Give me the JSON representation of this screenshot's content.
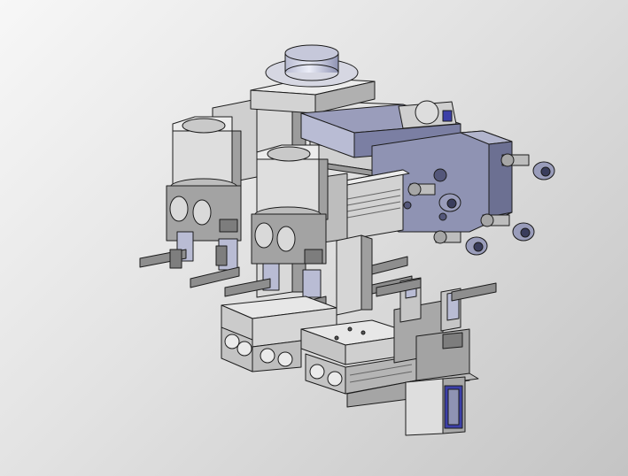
{
  "viewport": {
    "background_top": "#f7f7f7",
    "background_bottom": "#c4c4c4"
  },
  "model": {
    "palette": {
      "body_light": "#d8d8d8",
      "body_mid": "#bdbdbd",
      "body_dark": "#8e8e8e",
      "steel_blue": "#8f93b3",
      "steel_blue_dark": "#6c7092",
      "steel_blue_light": "#b9bcd4",
      "accent_blue": "#3c3fa8",
      "edge": "#1c1c1c"
    }
  }
}
